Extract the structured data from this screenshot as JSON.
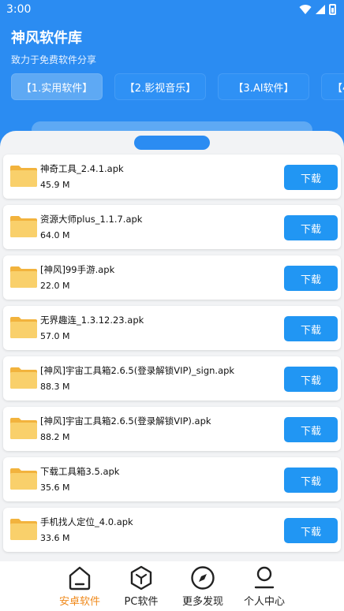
{
  "status_bar": {
    "time": "3:00"
  },
  "header": {
    "title": "神风软件库",
    "subtitle": "致力于免费软件分享",
    "tabs": [
      {
        "label": "【1.实用软件】",
        "active": true
      },
      {
        "label": "【2.影视音乐】",
        "active": false
      },
      {
        "label": "【3.AI软件】",
        "active": false
      },
      {
        "label": "【4",
        "active": false
      }
    ]
  },
  "files": [
    {
      "name": "神奇工具_2.4.1.apk",
      "size": "45.9 M",
      "button": "下载"
    },
    {
      "name": "资源大师plus_1.1.7.apk",
      "size": "64.0 M",
      "button": "下载"
    },
    {
      "name": "[神风]99手游.apk",
      "size": "22.0 M",
      "button": "下载"
    },
    {
      "name": "无界趣连_1.3.12.23.apk",
      "size": "57.0 M",
      "button": "下载"
    },
    {
      "name": " [神风]宇宙工具箱2.6.5(登录解锁VIP)_sign.apk",
      "size": "88.3 M",
      "button": "下载"
    },
    {
      "name": "[神风]宇宙工具箱2.6.5(登录解锁VIP).apk",
      "size": "88.2 M",
      "button": "下载"
    },
    {
      "name": "下载工具箱3.5.apk",
      "size": "35.6 M",
      "button": "下载"
    },
    {
      "name": "手机找人定位_4.0.apk",
      "size": "33.6 M",
      "button": "下载"
    }
  ],
  "bottom_nav": [
    {
      "label": "安卓软件",
      "icon": "home-icon",
      "active": true
    },
    {
      "label": "PC软件",
      "icon": "cube-icon",
      "active": false
    },
    {
      "label": "更多发现",
      "icon": "compass-icon",
      "active": false
    },
    {
      "label": "个人中心",
      "icon": "person-icon",
      "active": false
    }
  ],
  "colors": {
    "primary": "#2b8cf2",
    "button": "#2196f3",
    "active_nav": "#f08a1c",
    "folder": "#f7c55a"
  }
}
